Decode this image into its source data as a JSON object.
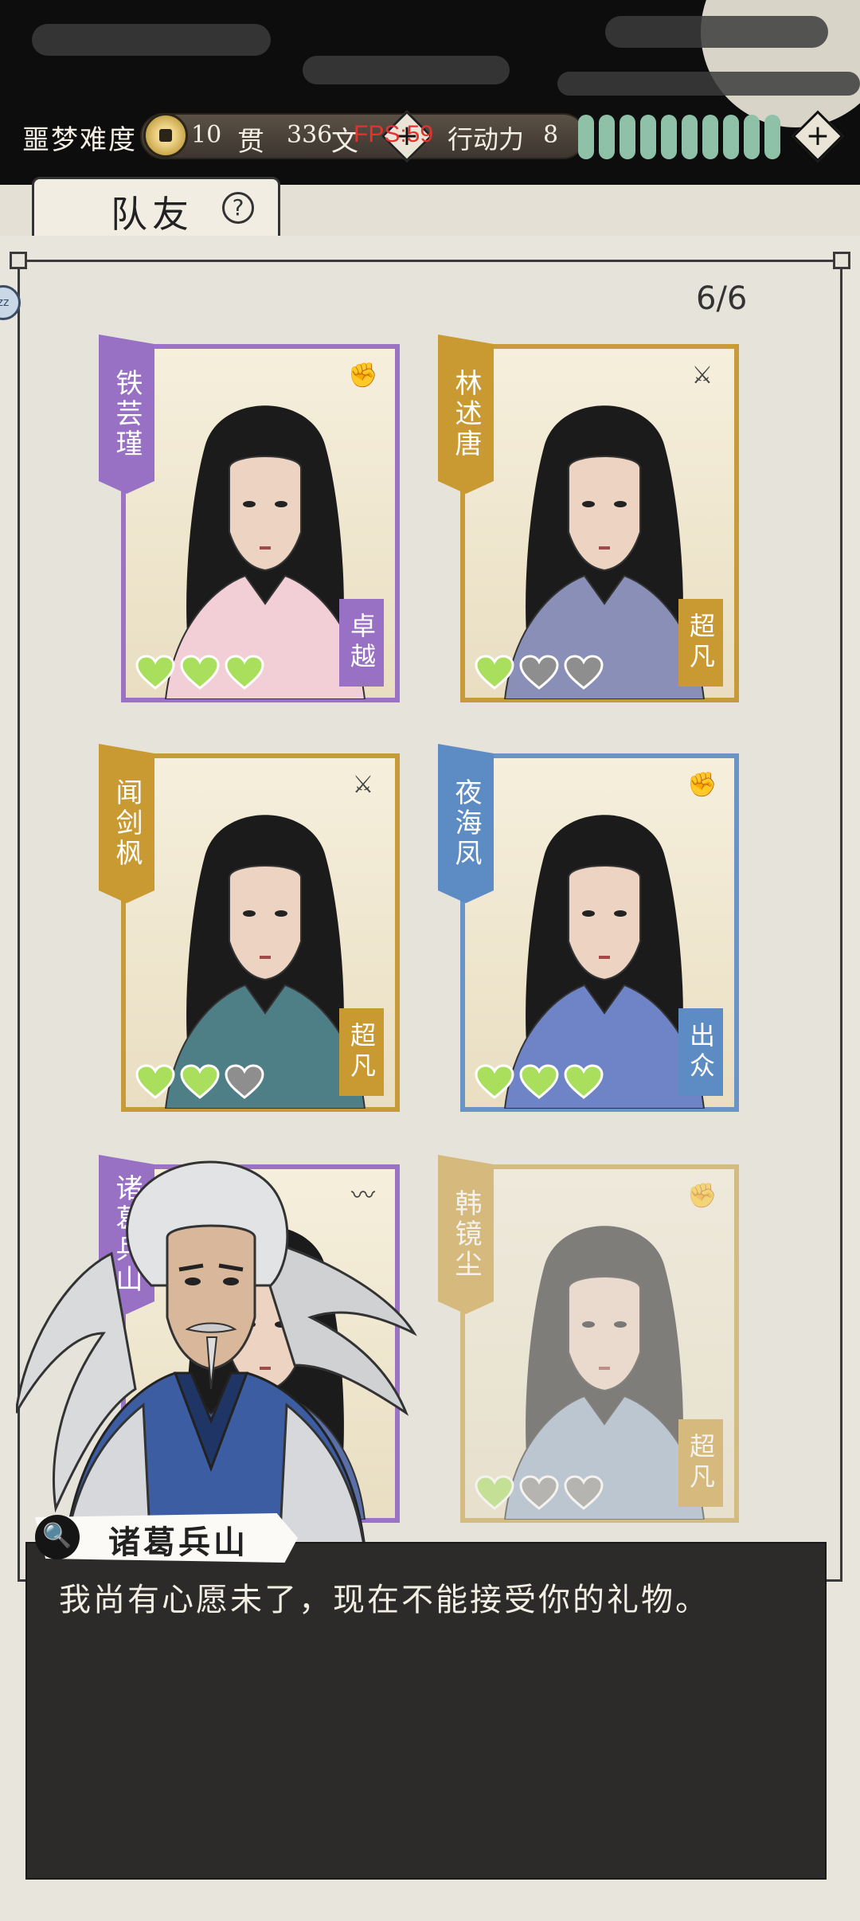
{
  "topbar": {
    "difficulty": "噩梦难度",
    "money_guan": "10",
    "money_guan_unit": "贯",
    "money_wen": "336",
    "money_wen_unit": "文",
    "fps": "FPS:59",
    "action_label": "行动力",
    "action_points": "8",
    "stamina_pips": 10,
    "add_symbol": "+"
  },
  "tab": {
    "label": "队友",
    "help": "?"
  },
  "panel": {
    "count": "6/6",
    "side_badge": "zz"
  },
  "cards": [
    {
      "name": "铁芸瑾",
      "grade": "卓越",
      "color": "purple",
      "weapon": "fist-icon",
      "weapon_glyph": "✊",
      "hearts_full": 3
    },
    {
      "name": "林述唐",
      "grade": "超凡",
      "color": "gold",
      "weapon": "sword-icon",
      "weapon_glyph": "⚔",
      "hearts_full": 1
    },
    {
      "name": "闻剑枫",
      "grade": "超凡",
      "color": "gold",
      "weapon": "sword-icon",
      "weapon_glyph": "⚔",
      "hearts_full": 2
    },
    {
      "name": "夜海凤",
      "grade": "出众",
      "color": "blue",
      "weapon": "fist-icon",
      "weapon_glyph": "✊",
      "hearts_full": 3
    },
    {
      "name": "诸葛兵山",
      "grade": "",
      "color": "purple",
      "weapon": "whip-icon",
      "weapon_glyph": "〰",
      "hearts_full": 0
    },
    {
      "name": "韩镜尘",
      "grade": "超凡",
      "color": "gold",
      "weapon": "fist-icon",
      "weapon_glyph": "✊",
      "hearts_full": 1
    }
  ],
  "dialog": {
    "speaker": "诸葛兵山",
    "text": "我尚有心愿未了，现在不能接受你的礼物。",
    "search_glyph": "🔍"
  }
}
